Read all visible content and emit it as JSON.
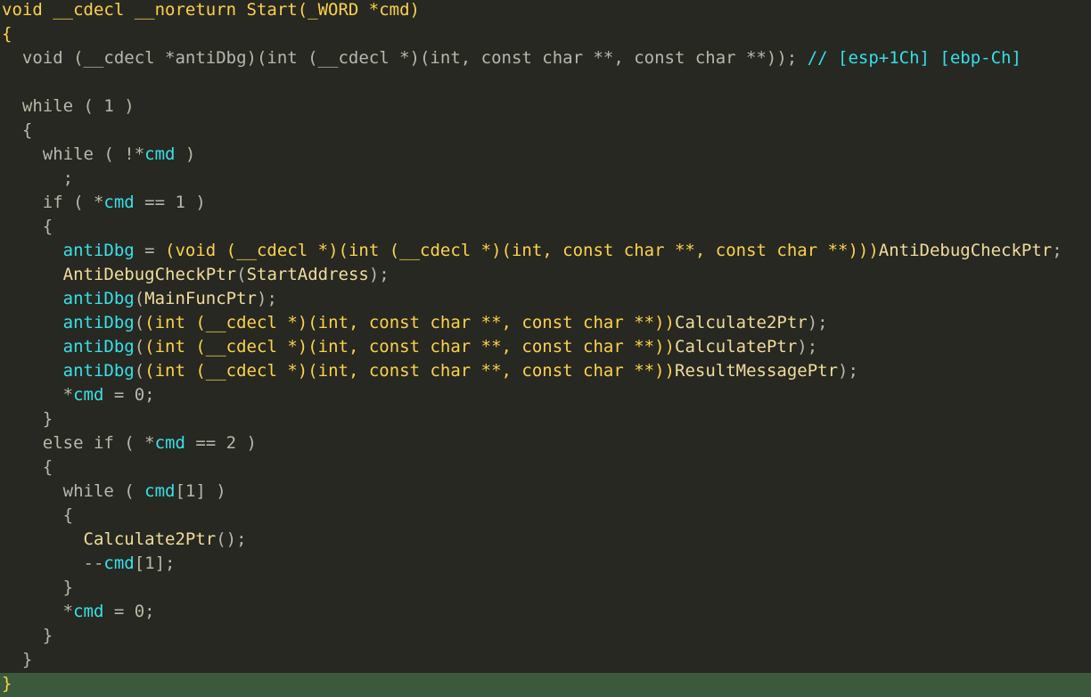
{
  "colors": {
    "background": "#272822",
    "keyword": "#fcd24a",
    "plain": "#b8b8a8",
    "variable": "#38e0e8",
    "function": "#f0dc9c",
    "comment": "#32e0e8",
    "current_line": "#3b5a3b"
  },
  "current_line_index": 28,
  "lines": [
    [
      [
        "kw",
        "void __cdecl __noreturn Start(_WORD *cmd)"
      ]
    ],
    [
      [
        "brace",
        "{"
      ]
    ],
    [
      [
        "plain",
        "  void (__cdecl *antiDbg)(int (__cdecl *)(int, const char **, const char **)); "
      ],
      [
        "cmt",
        "// [esp+1Ch] [ebp-Ch]"
      ]
    ],
    [],
    [
      [
        "plain",
        "  while ( 1 )"
      ]
    ],
    [
      [
        "plain",
        "  {"
      ]
    ],
    [
      [
        "plain",
        "    while ( !*"
      ],
      [
        "var",
        "cmd"
      ],
      [
        "plain",
        " )"
      ]
    ],
    [
      [
        "plain",
        "      ;"
      ]
    ],
    [
      [
        "plain",
        "    if ( *"
      ],
      [
        "var",
        "cmd"
      ],
      [
        "plain",
        " == 1 )"
      ]
    ],
    [
      [
        "plain",
        "    {"
      ]
    ],
    [
      [
        "var",
        "      antiDbg"
      ],
      [
        "plain",
        " = "
      ],
      [
        "kw",
        "(void (__cdecl *)(int (__cdecl *)(int, const char **, const char **)))"
      ],
      [
        "fn",
        "AntiDebugCheckPtr"
      ],
      [
        "plain",
        ";"
      ]
    ],
    [
      [
        "fn",
        "      AntiDebugCheckPtr"
      ],
      [
        "plain",
        "("
      ],
      [
        "fn",
        "StartAddress"
      ],
      [
        "plain",
        ");"
      ]
    ],
    [
      [
        "var",
        "      antiDbg"
      ],
      [
        "plain",
        "("
      ],
      [
        "fn",
        "MainFuncPtr"
      ],
      [
        "plain",
        ");"
      ]
    ],
    [
      [
        "var",
        "      antiDbg"
      ],
      [
        "plain",
        "("
      ],
      [
        "kw",
        "(int (__cdecl *)(int, const char **, const char **))"
      ],
      [
        "fn",
        "Calculate2Ptr"
      ],
      [
        "plain",
        ");"
      ]
    ],
    [
      [
        "var",
        "      antiDbg"
      ],
      [
        "plain",
        "("
      ],
      [
        "kw",
        "(int (__cdecl *)(int, const char **, const char **))"
      ],
      [
        "fn",
        "CalculatePtr"
      ],
      [
        "plain",
        ");"
      ]
    ],
    [
      [
        "var",
        "      antiDbg"
      ],
      [
        "plain",
        "("
      ],
      [
        "kw",
        "(int (__cdecl *)(int, const char **, const char **))"
      ],
      [
        "fn",
        "ResultMessagePtr"
      ],
      [
        "plain",
        ");"
      ]
    ],
    [
      [
        "plain",
        "      *"
      ],
      [
        "var",
        "cmd"
      ],
      [
        "plain",
        " = 0;"
      ]
    ],
    [
      [
        "plain",
        "    }"
      ]
    ],
    [
      [
        "plain",
        "    else if ( *"
      ],
      [
        "var",
        "cmd"
      ],
      [
        "plain",
        " == 2 )"
      ]
    ],
    [
      [
        "plain",
        "    {"
      ]
    ],
    [
      [
        "plain",
        "      while ( "
      ],
      [
        "var",
        "cmd"
      ],
      [
        "plain",
        "[1] )"
      ]
    ],
    [
      [
        "plain",
        "      {"
      ]
    ],
    [
      [
        "fn",
        "        Calculate2Ptr"
      ],
      [
        "plain",
        "();"
      ]
    ],
    [
      [
        "plain",
        "        --"
      ],
      [
        "var",
        "cmd"
      ],
      [
        "plain",
        "[1];"
      ]
    ],
    [
      [
        "plain",
        "      }"
      ]
    ],
    [
      [
        "plain",
        "      *"
      ],
      [
        "var",
        "cmd"
      ],
      [
        "plain",
        " = 0;"
      ]
    ],
    [
      [
        "plain",
        "    }"
      ]
    ],
    [
      [
        "plain",
        "  }"
      ]
    ],
    [
      [
        "brace",
        "}"
      ]
    ]
  ]
}
